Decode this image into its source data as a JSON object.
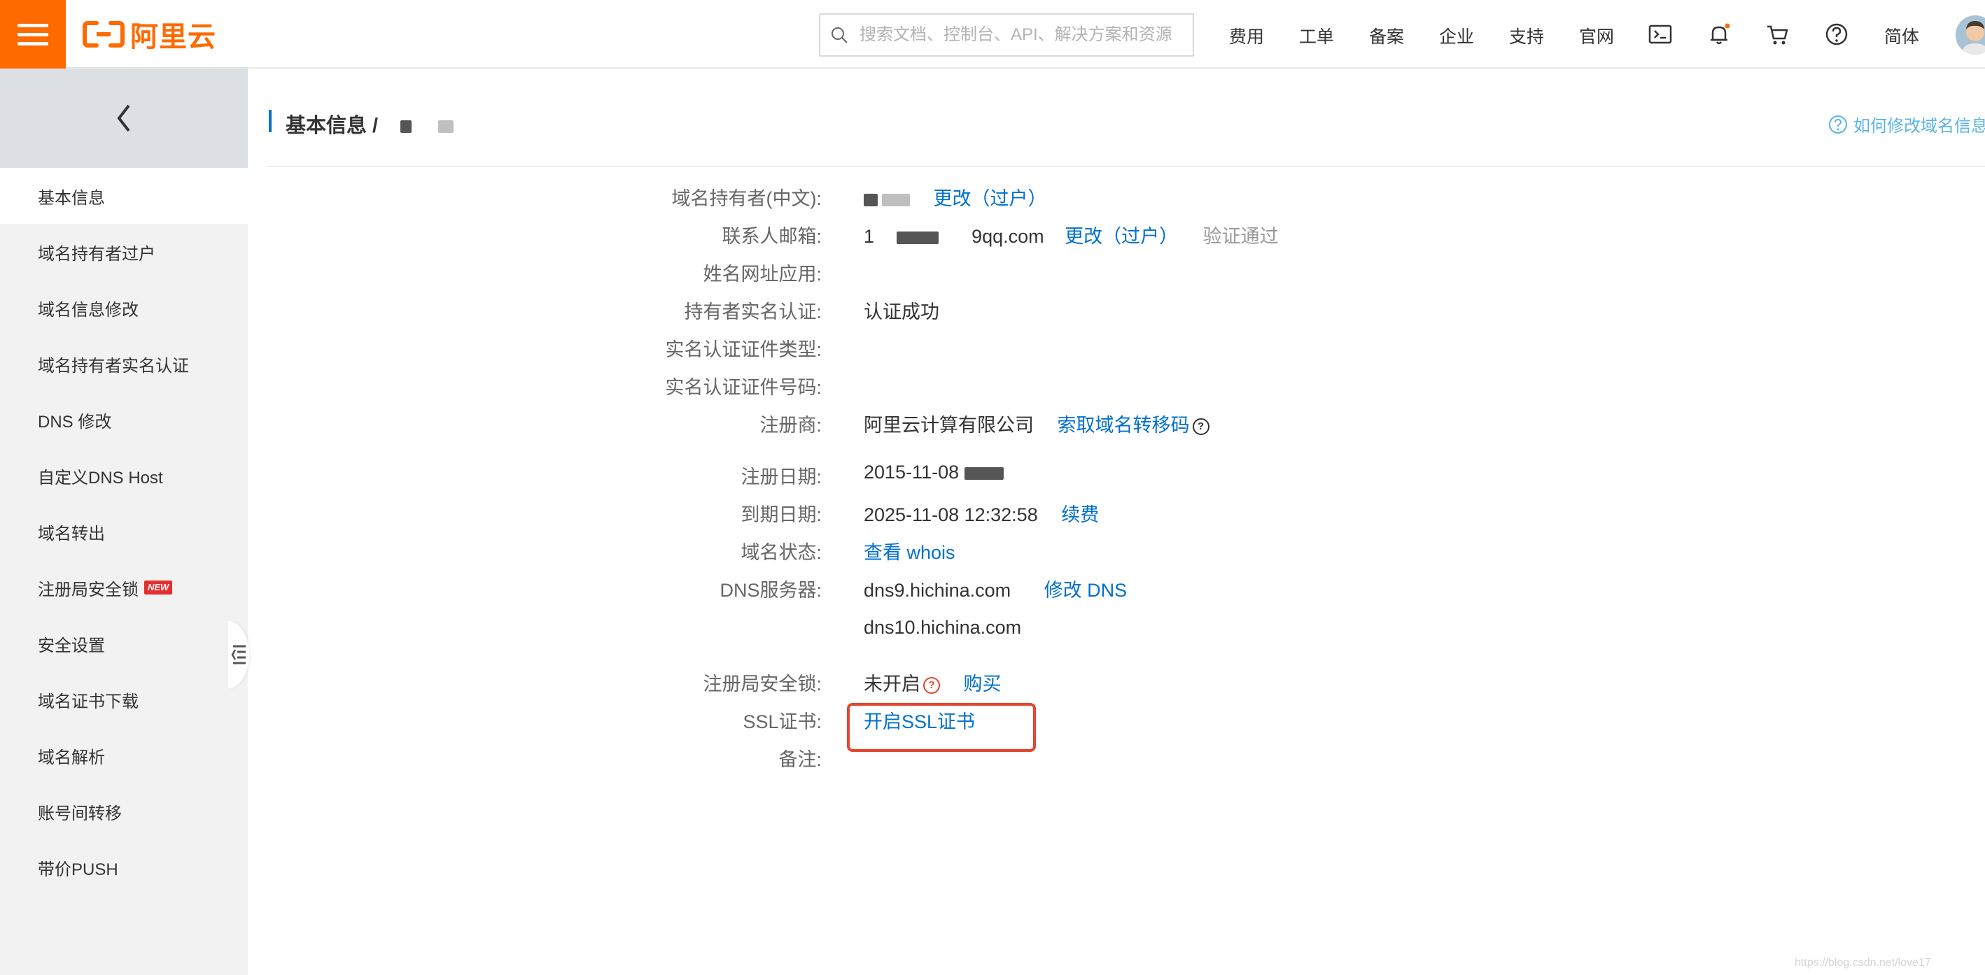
{
  "topbar": {
    "logo_text": "阿里云",
    "search_placeholder": "搜索文档、控制台、API、解决方案和资源",
    "nav_items": [
      "费用",
      "工单",
      "备案",
      "企业",
      "支持",
      "官网"
    ],
    "lang": "简体",
    "icons": [
      "terminal-icon",
      "bell-icon",
      "cart-icon",
      "help-icon"
    ],
    "accent_color": "#ff6a00"
  },
  "sidebar": {
    "items": [
      {
        "label": "基本信息"
      },
      {
        "label": "域名持有者过户"
      },
      {
        "label": "域名信息修改"
      },
      {
        "label": "域名持有者实名认证"
      },
      {
        "label": "DNS 修改"
      },
      {
        "label": "自定义DNS Host"
      },
      {
        "label": "域名转出"
      },
      {
        "label": "注册局安全锁",
        "badge": "NEW"
      },
      {
        "label": "安全设置"
      },
      {
        "label": "域名证书下载"
      },
      {
        "label": "域名解析"
      },
      {
        "label": "账号间转移"
      },
      {
        "label": "带价PUSH"
      }
    ]
  },
  "header": {
    "title": "基本信息 /",
    "help_link": "如何修改域名信息"
  },
  "details": {
    "owner_label": "域名持有者(中文):",
    "owner_action": "更改（过户）",
    "email_label": "联系人邮箱:",
    "email_value_prefix": "1",
    "email_value_suffix": "9qq.com",
    "email_action": "更改（过户）",
    "email_status": "验证通过",
    "name_url_label": "姓名网址应用:",
    "realname_label": "持有者实名认证:",
    "realname_value": "认证成功",
    "cert_type_label": "实名认证证件类型:",
    "cert_no_label": "实名认证证件号码:",
    "registrar_label": "注册商:",
    "registrar_value": "阿里云计算有限公司",
    "registrar_action": "索取域名转移码",
    "reg_date_label": "注册日期:",
    "reg_date_value": "2015-11-08 ",
    "expire_label": "到期日期:",
    "expire_value": "2025-11-08 12:32:58",
    "expire_action": "续费",
    "status_label": "域名状态:",
    "status_action": "查看 whois",
    "dns_label": "DNS服务器:",
    "dns1": "dns9.hichina.com",
    "dns_action": "修改 DNS",
    "dns2": "dns10.hichina.com",
    "lock_label": "注册局安全锁:",
    "lock_value": "未开启",
    "lock_action": "购买",
    "ssl_label": "SSL证书:",
    "ssl_action": "开启SSL证书",
    "remark_label": "备注:"
  },
  "watermark": "https://blog.csdn.net/love17"
}
